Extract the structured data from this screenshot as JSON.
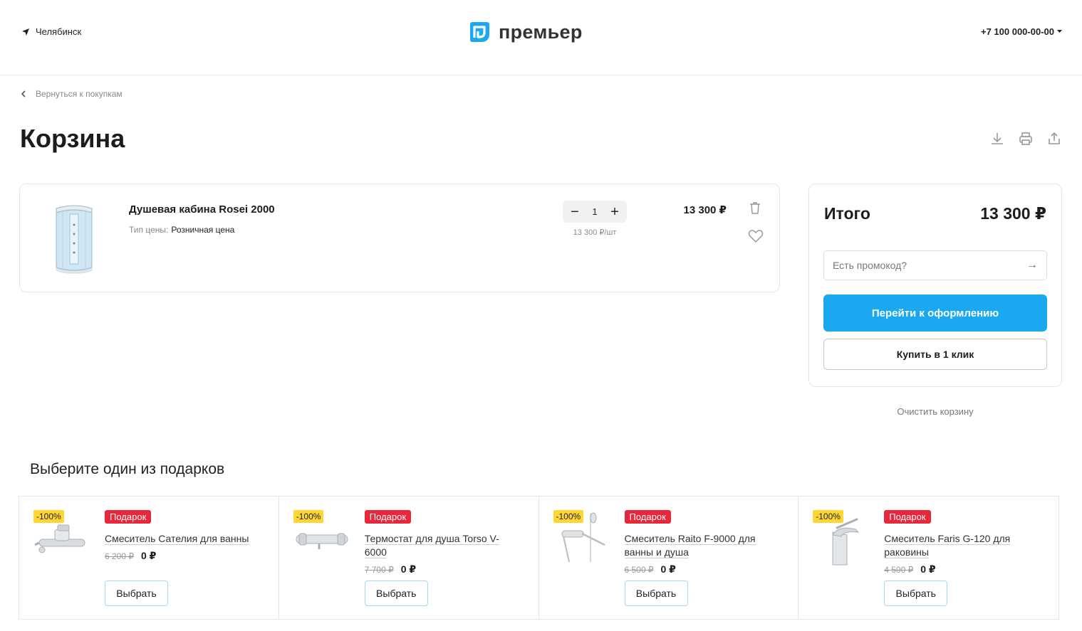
{
  "header": {
    "city": "Челябинск",
    "logo_text": "премьер",
    "phone": "+7 100 000-00-00"
  },
  "nav": {
    "back_label": "Вернуться к покупкам"
  },
  "page": {
    "title": "Корзина"
  },
  "cart_item": {
    "name": "Душевая кабина Rosei 2000",
    "price_type_label": "Тип цены:",
    "price_type_value": "Розничная цена",
    "quantity": "1",
    "unit_price": "13 300 ₽/шт",
    "total": "13 300 ₽"
  },
  "summary": {
    "label": "Итого",
    "value": "13 300 ₽",
    "promo_placeholder": "Есть промокод?",
    "checkout_label": "Перейти к оформлению",
    "oneclick_label": "Купить в 1 клик",
    "clear_label": "Очистить корзину"
  },
  "gifts": {
    "title": "Выберите один из подарков",
    "items": [
      {
        "discount": "-100%",
        "badge": "Подарок",
        "name": "Смеситель Сателия для ванны",
        "old_price": "6 200 ₽",
        "new_price": "0 ₽",
        "button": "Выбрать"
      },
      {
        "discount": "-100%",
        "badge": "Подарок",
        "name": "Термостат для душа Torso V-6000",
        "old_price": "7 700 ₽",
        "new_price": "0 ₽",
        "button": "Выбрать"
      },
      {
        "discount": "-100%",
        "badge": "Подарок",
        "name": "Смеситель Raito F-9000 для ванны и душа",
        "old_price": "6 500 ₽",
        "new_price": "0 ₽",
        "button": "Выбрать"
      },
      {
        "discount": "-100%",
        "badge": "Подарок",
        "name": "Смеситель Faris G-120 для раковины",
        "old_price": "4 500 ₽",
        "new_price": "0 ₽",
        "button": "Выбрать"
      }
    ]
  },
  "colors": {
    "accent": "#1aa9f0",
    "gift_badge": "#e8283a",
    "discount_badge": "#ffd633"
  }
}
